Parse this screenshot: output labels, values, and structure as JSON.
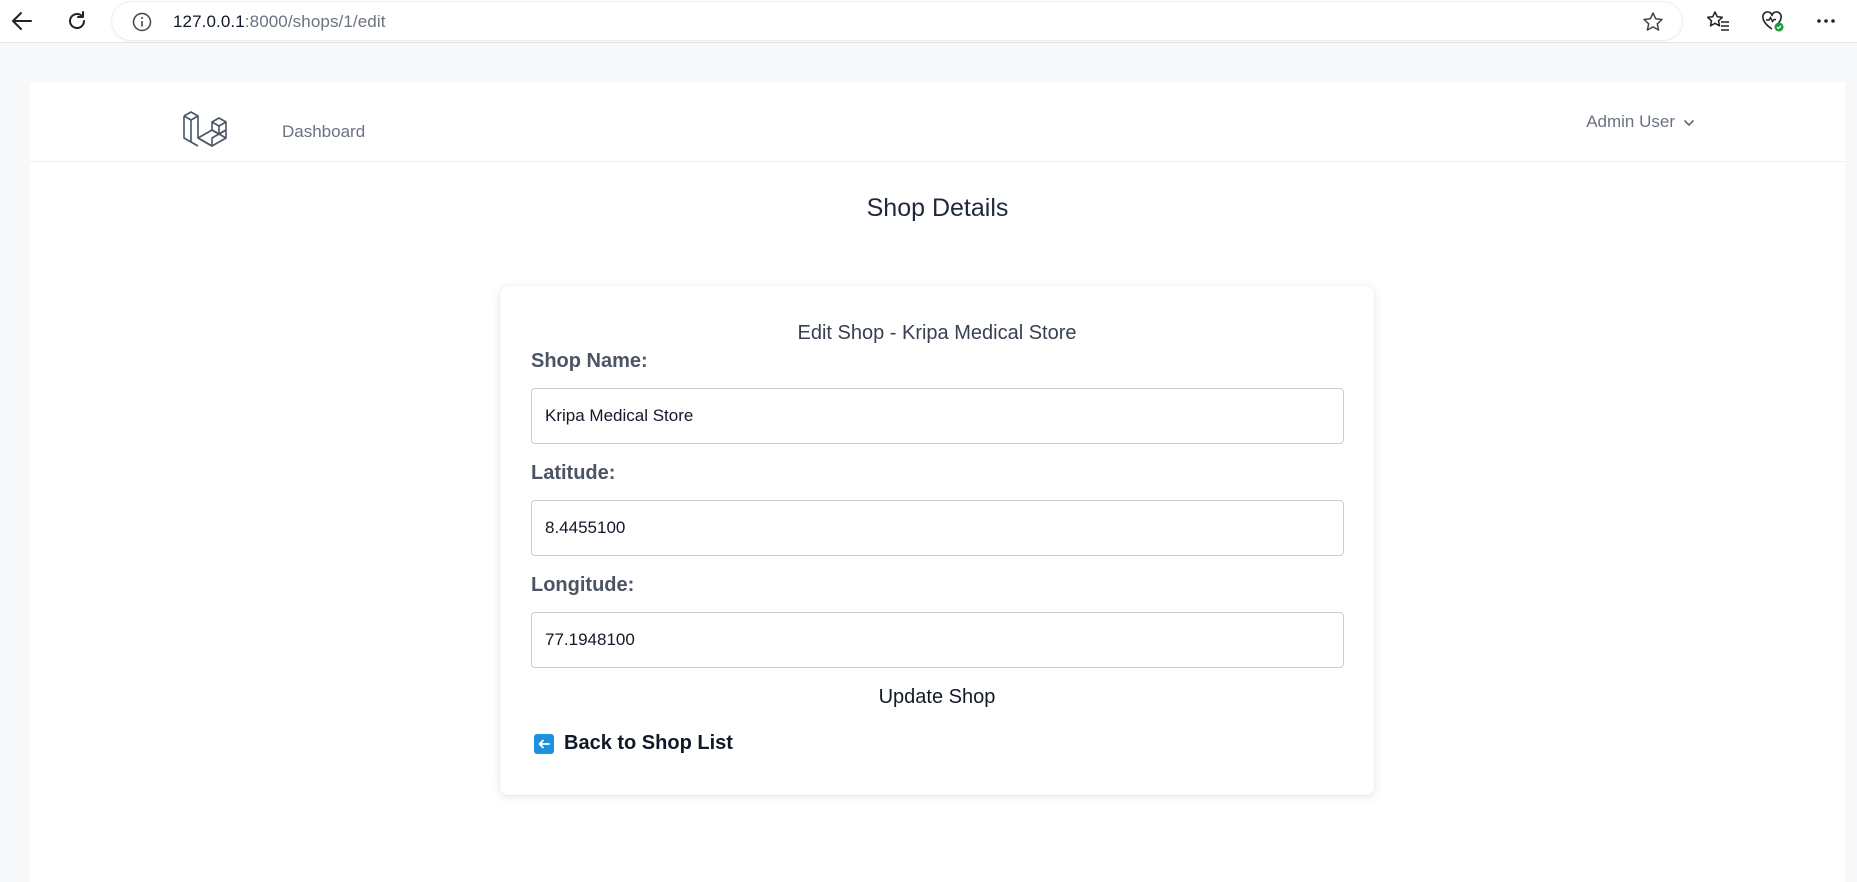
{
  "browser": {
    "url_host": "127.0.0.1",
    "url_path": ":8000/shops/1/edit"
  },
  "nav": {
    "dashboard_label": "Dashboard",
    "user_name": "Admin User"
  },
  "page": {
    "title": "Shop Details"
  },
  "form": {
    "heading": "Edit Shop - Kripa Medical Store",
    "shop_name_label": "Shop Name:",
    "shop_name_value": "Kripa Medical Store",
    "latitude_label": "Latitude:",
    "latitude_value": "8.4455100",
    "longitude_label": "Longitude:",
    "longitude_value": "77.1948100",
    "submit_label": "Update Shop",
    "back_label": "Back to Shop List"
  },
  "colors": {
    "accent_icon": "#1e90e0",
    "browser_badge": "#1a9b3b"
  }
}
